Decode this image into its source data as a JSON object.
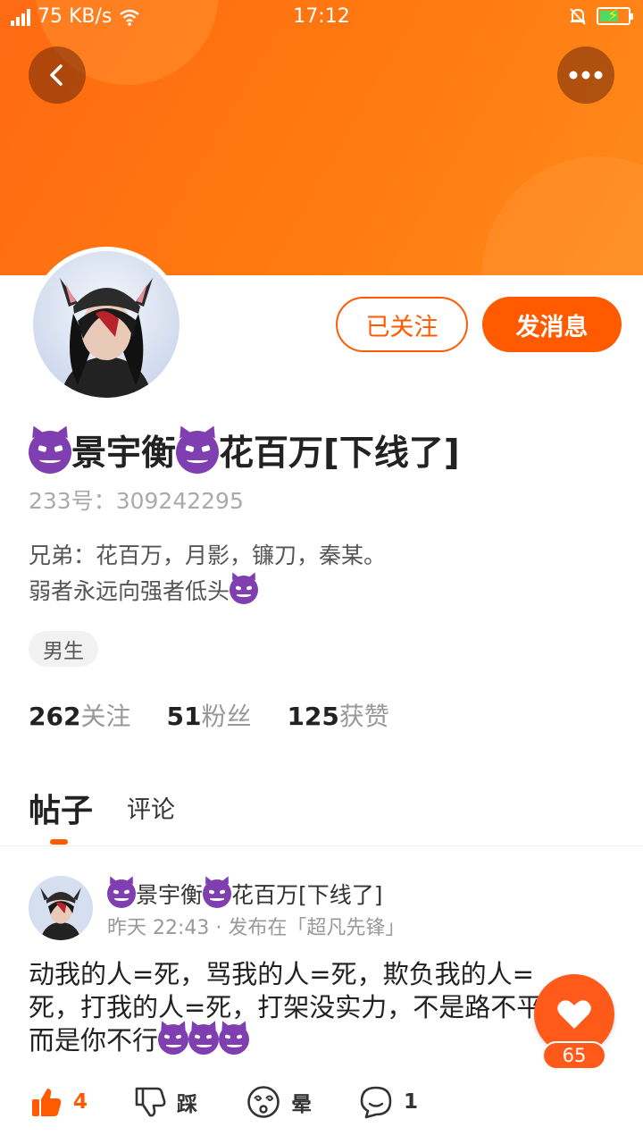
{
  "status_bar": {
    "speed": "75 KB/s",
    "time": "17:12"
  },
  "profile": {
    "name_left": "景宇衡",
    "name_right": "花百万[下线了]",
    "uid_label": "233号：",
    "uid": "309242295",
    "bio_line1": "兄弟：花百万，月影，镰刀，秦某。",
    "bio_line2": "弱者永远向强者低头",
    "tag": "男生",
    "follow_label": "已关注",
    "message_label": "发消息"
  },
  "stats": [
    {
      "num": "262",
      "label": "关注"
    },
    {
      "num": "51",
      "label": "粉丝"
    },
    {
      "num": "125",
      "label": "获赞"
    }
  ],
  "tabs": {
    "posts": "帖子",
    "comments": "评论"
  },
  "post": {
    "author_left": "景宇衡",
    "author_right": "花百万[下线了]",
    "meta": "昨天 22:43 · 发布在「超凡先锋」",
    "body_text": "动我的人=死，骂我的人=死，欺负我的人=死，打我的人=死，打架没实力，不是路不平，而是你不行",
    "likes": "4",
    "dislike_label": "踩",
    "dizzy_label": "晕",
    "comments": "1"
  },
  "fab": {
    "count": "65"
  },
  "colors": {
    "accent": "#ff5a00",
    "banner": "#ff7a10",
    "emoji": "#7f3fb0"
  },
  "icons": [
    "back-arrow-icon",
    "more-dots-icon",
    "thumbs-up-icon",
    "thumbs-down-icon",
    "dizzy-face-icon",
    "comment-bubble-icon",
    "heart-icon",
    "devil-emoji-icon"
  ]
}
